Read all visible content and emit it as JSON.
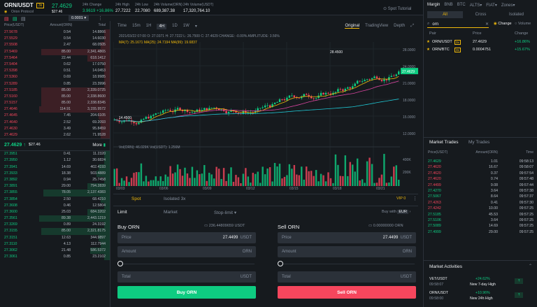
{
  "header": {
    "symbol": "ORN/USDT",
    "tag": "3x",
    "project": "Orion Protocol",
    "price": "27.4629",
    "price_usd": "$27.46",
    "stats": [
      {
        "label": "24h Change",
        "value": "3.9619 +16.86%",
        "color": "green"
      },
      {
        "label": "24h High",
        "value": "27.7222",
        "color": "white"
      },
      {
        "label": "24h Low",
        "value": "22.7080",
        "color": "white"
      },
      {
        "label": "24h Volume(ORN)",
        "value": "689,387.38",
        "color": "white"
      },
      {
        "label": "24h Volume(USDT)",
        "value": "17,320,764.10",
        "color": "white"
      }
    ],
    "tutorial": "Spot Tutorial"
  },
  "orderbook": {
    "precision": "0.0001",
    "headers": [
      "Price(USDT)",
      "Amount(ORN)",
      "Total"
    ],
    "asks": [
      {
        "p": "27.5678",
        "a": "0.54",
        "t": "14.8866",
        "d": 0.05
      },
      {
        "p": "27.5529",
        "a": "0.54",
        "t": "14.6030",
        "d": 0.05
      },
      {
        "p": "27.5508",
        "a": "2.47",
        "t": "68.0505",
        "d": 0.08
      },
      {
        "p": "27.5469",
        "a": "85.00",
        "t": "2,341.4865",
        "d": 0.62
      },
      {
        "p": "27.5464",
        "a": "22.44",
        "t": "618.1412",
        "d": 0.2
      },
      {
        "p": "27.5404",
        "a": "0.62",
        "t": "17.0750",
        "d": 0.05
      },
      {
        "p": "27.5398",
        "a": "0.51",
        "t": "14.0453",
        "d": 0.05
      },
      {
        "p": "27.5360",
        "a": "0.69",
        "t": "18.9985",
        "d": 0.05
      },
      {
        "p": "27.5289",
        "a": "0.85",
        "t": "23.3996",
        "d": 0.05
      },
      {
        "p": "27.5185",
        "a": "85.00",
        "t": "2,339.0725",
        "d": 0.62
      },
      {
        "p": "27.5160",
        "a": "85.00",
        "t": "2,338.8600",
        "d": 0.62
      },
      {
        "p": "27.5157",
        "a": "85.00",
        "t": "2,338.8345",
        "d": 0.62
      },
      {
        "p": "27.4646",
        "a": "114.91",
        "t": "3,155.9572",
        "d": 0.64
      },
      {
        "p": "27.4645",
        "a": "7.45",
        "t": "204.6105",
        "d": 0.1
      },
      {
        "p": "27.4640",
        "a": "2.52",
        "t": "69.2093",
        "d": 0.08
      },
      {
        "p": "27.4630",
        "a": "3.49",
        "t": "95.8459",
        "d": 0.08
      },
      {
        "p": "27.4629",
        "a": "2.62",
        "t": "71.9528",
        "d": 0.08
      }
    ],
    "mid_price": "27.4629",
    "mid_arrow": "↑",
    "mid_usd": "$27.46",
    "more": "More",
    "bids": [
      {
        "p": "27.3951",
        "a": "0.41",
        "t": "11.2320",
        "d": 0.05
      },
      {
        "p": "27.3950",
        "a": "1.12",
        "t": "30.6824",
        "d": 0.05
      },
      {
        "p": "27.3941",
        "a": "14.69",
        "t": "402.4193",
        "d": 0.1
      },
      {
        "p": "27.3933",
        "a": "18.38",
        "t": "503.4889",
        "d": 0.12
      },
      {
        "p": "27.3892",
        "a": "0.94",
        "t": "25.7458",
        "d": 0.05
      },
      {
        "p": "27.3891",
        "a": "29.00",
        "t": "794.2839",
        "d": 0.2
      },
      {
        "p": "27.3855",
        "a": "78.05",
        "t": "2,137.4383",
        "d": 0.6
      },
      {
        "p": "27.3854",
        "a": "2.50",
        "t": "68.4210",
        "d": 0.08
      },
      {
        "p": "27.3608",
        "a": "0.46",
        "t": "12.5804",
        "d": 0.05
      },
      {
        "p": "27.3600",
        "a": "25.03",
        "t": "684.3202",
        "d": 0.2
      },
      {
        "p": "27.3561",
        "a": "89.38",
        "t": "2,443.1219",
        "d": 0.64
      },
      {
        "p": "27.3269",
        "a": "0.89",
        "t": "24.3192",
        "d": 0.05
      },
      {
        "p": "27.3155",
        "a": "85.00",
        "t": "2,321.8175",
        "d": 0.62
      },
      {
        "p": "27.3151",
        "a": "12.63",
        "t": "344.9897",
        "d": 0.1
      },
      {
        "p": "27.3110",
        "a": "4.13",
        "t": "112.7944",
        "d": 0.08
      },
      {
        "p": "27.3062",
        "a": "21.48",
        "t": "586.5372",
        "d": 0.18
      },
      {
        "p": "27.3061",
        "a": "0.85",
        "t": "23.2102",
        "d": 0.05
      }
    ]
  },
  "chart": {
    "timeframes": [
      "Time",
      "15m",
      "1H",
      "4H",
      "1D",
      "1W"
    ],
    "active_tf": "4H",
    "views": [
      "Original",
      "TradingView",
      "Depth"
    ],
    "active_view": "Original",
    "ohlc": "2021/03/22 07:00 O: 27.0371 H: 27.7222 L: 26.7500 C: 27.4629 CHANGE: -0.00% AMPLITUDE: 3.56%",
    "ma": "MA(7): 25.1671  MA(25): 24.7194  MA(99): 19.6837",
    "vol": "Vol(ORN): 46.029K  Vol(USDT): 1.256M",
    "price_label": "27.4629",
    "high_label": "28.4500",
    "low_label": "14.4500",
    "y_ticks": [
      "28.0000",
      "24.0000",
      "21.0000",
      "18.0000",
      "15.0000",
      "12.0000"
    ],
    "vol_ticks": [
      "400K",
      "200K"
    ],
    "x_ticks": [
      "03/03",
      "03/06",
      "03/09",
      "03/12",
      "03/15",
      "03/18",
      "03/21"
    ]
  },
  "trade": {
    "tabs": [
      "Spot",
      "Isolated 3x"
    ],
    "vip": "VIP 0",
    "order_types": [
      "Limit",
      "Market",
      "Stop-limit"
    ],
    "buy_with": "Buy with",
    "buy_currency": "EUR",
    "buy": {
      "title": "Buy ORN",
      "balance": "236.44809659 USDT",
      "price_label": "Price",
      "price_value": "27.4499",
      "price_unit": "USDT",
      "amount_label": "Amount",
      "amount_unit": "ORN",
      "total_label": "Total",
      "total_unit": "USDT",
      "button": "Buy ORN"
    },
    "sell": {
      "title": "Sell ORN",
      "balance": "0.00000000 ORN",
      "price_label": "Price",
      "price_value": "27.4499",
      "price_unit": "USDT",
      "amount_label": "Amount",
      "amount_unit": "ORN",
      "total_label": "Total",
      "total_unit": "USDT",
      "button": "Sell ORN"
    }
  },
  "right": {
    "top_tabs": [
      "Margin",
      "BNB",
      "BTC",
      "ALTS▾",
      "FIAT▾",
      "Zones▾"
    ],
    "sub_tabs": [
      "All",
      "Cross",
      "Isolated"
    ],
    "search_value": "orn",
    "radio_change": "Change",
    "radio_volume": "Volume",
    "pair_headers": [
      "Pair",
      "Price",
      "Change"
    ],
    "pairs": [
      {
        "pair": "ORN/USDT",
        "tag": "3x",
        "price": "27.4629",
        "change": "+16.86%"
      },
      {
        "pair": "ORN/BTC",
        "tag": "3x",
        "price": "0.0004751",
        "change": "+15.67%"
      }
    ],
    "trade_tabs": [
      "Market Trades",
      "My Trades"
    ],
    "trade_headers": [
      "Price(USDT)",
      "Amount(ORN)",
      "Time"
    ],
    "trades": [
      {
        "p": "27.4629",
        "a": "1.01",
        "t": "09:58:13",
        "c": "g"
      },
      {
        "p": "27.4620",
        "a": "16.67",
        "t": "09:58:07",
        "c": "r"
      },
      {
        "p": "27.4620",
        "a": "0.37",
        "t": "09:57:54",
        "c": "r"
      },
      {
        "p": "27.4620",
        "a": "0.74",
        "t": "09:57:48",
        "c": "r"
      },
      {
        "p": "27.4499",
        "a": "9.08",
        "t": "09:57:44",
        "c": "r"
      },
      {
        "p": "27.4270",
        "a": "3.64",
        "t": "09:57:38",
        "c": "g"
      },
      {
        "p": "27.5067",
        "a": "8.64",
        "t": "09:57:37",
        "c": "g"
      },
      {
        "p": "27.4263",
        "a": "0.41",
        "t": "09:57:30",
        "c": "r"
      },
      {
        "p": "27.4242",
        "a": "10.00",
        "t": "09:57:25",
        "c": "r"
      },
      {
        "p": "27.5185",
        "a": "45.53",
        "t": "09:57:25",
        "c": "g"
      },
      {
        "p": "27.5106",
        "a": "3.64",
        "t": "09:57:25",
        "c": "g"
      },
      {
        "p": "27.5089",
        "a": "14.69",
        "t": "09:57:25",
        "c": "g"
      },
      {
        "p": "27.4999",
        "a": "29.00",
        "t": "09:57:25",
        "c": "g"
      }
    ],
    "activities_title": "Market Activities",
    "activities": [
      {
        "pair": "VET/USDT",
        "time": "09:58:07",
        "change": "+24.62%",
        "desc": "New 7-day High"
      },
      {
        "pair": "ORN/USDT",
        "time": "09:58:00",
        "change": "+10.96%",
        "desc": "New 24h High"
      }
    ]
  }
}
